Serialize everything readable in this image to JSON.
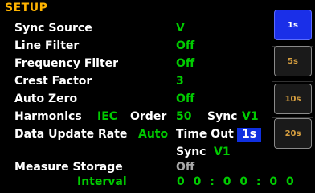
{
  "title": "SETUP",
  "rows": {
    "sync_source": {
      "label": "Sync Source",
      "value": "V"
    },
    "line_filter": {
      "label": "Line Filter",
      "value": "Off"
    },
    "frequency_filter": {
      "label": "Frequency Filter",
      "value": "Off"
    },
    "crest_factor": {
      "label": "Crest Factor",
      "value": "3"
    },
    "auto_zero": {
      "label": "Auto Zero",
      "value": "Off"
    },
    "harmonics": {
      "label": "Harmonics",
      "standard": "IEC",
      "order_label": "Order",
      "order_value": "50",
      "sync_label": "Sync",
      "sync_value": "V1"
    },
    "data_update": {
      "label": "Data Update Rate",
      "mode": "Auto",
      "timeout_label": "Time Out",
      "timeout_value": "1s",
      "sync_label": "Sync",
      "sync_value": "V1"
    },
    "measure_storage": {
      "label": "Measure Storage",
      "value": "Off",
      "interval_label": "Interval",
      "interval_value": "0 0 : 0 0 : 0 0"
    }
  },
  "softkeys": [
    {
      "label": "1s",
      "active": true
    },
    {
      "label": "5s",
      "active": false
    },
    {
      "label": "10s",
      "active": false
    },
    {
      "label": "20s",
      "active": false
    }
  ],
  "colors": {
    "title": "#ffb400",
    "value": "#00cc00",
    "selected": "#1030e0",
    "softkey_text": "#d8a040"
  }
}
